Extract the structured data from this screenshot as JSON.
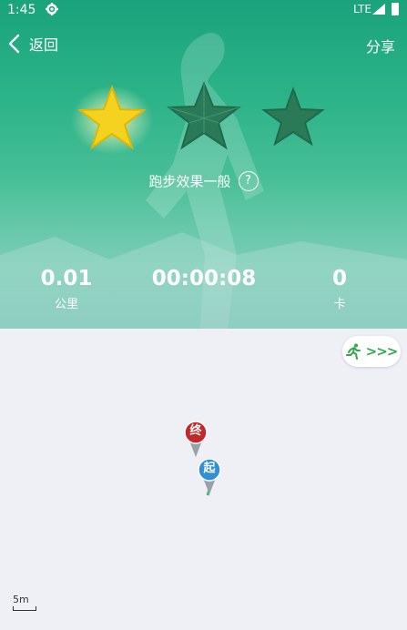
{
  "status_bar": {
    "time": "1:45",
    "network": "LTE"
  },
  "header": {
    "back_label": "返回",
    "share_label": "分享"
  },
  "rating": {
    "stars_filled": 1,
    "stars_total": 3,
    "text": "跑步效果一般",
    "help_symbol": "?"
  },
  "stats": [
    {
      "value": "0.01",
      "unit": "公里"
    },
    {
      "value": "00:00:08",
      "unit": ""
    },
    {
      "value": "0",
      "unit": "卡"
    }
  ],
  "map": {
    "start_marker": "起",
    "end_marker": "终",
    "scale_label": "5m",
    "replay_arrows": ">>>"
  },
  "colors": {
    "accent_green": "#2fa84f",
    "hero_green": "#2cb388",
    "start_blue": "#2f8fd8",
    "end_red": "#c0282a",
    "star_gold": "#f5d21f",
    "star_dim": "#2a7a58"
  }
}
